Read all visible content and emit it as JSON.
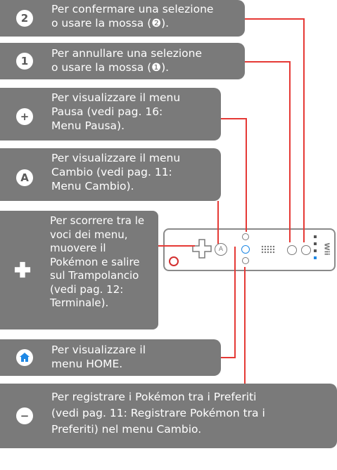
{
  "boxes": [
    {
      "icon": "2",
      "lines": [
        "Per confermare una selezione",
        "o usare la mossa (❷)."
      ]
    },
    {
      "icon": "1",
      "lines": [
        "Per annullare una selezione",
        "o usare la mossa (❶)."
      ]
    },
    {
      "icon": "+",
      "lines": [
        "Per visualizzare il menu",
        "Pausa (vedi pag. 16:",
        "Menu Pausa)."
      ]
    },
    {
      "icon": "A",
      "lines": [
        "Per visualizzare il menu",
        "Cambio (vedi pag. 11:",
        "Menu Cambio)."
      ]
    },
    {
      "icon": "dpad",
      "lines": [
        "Per scorrere tra le",
        "voci dei menu,",
        "muovere il",
        "Pokémon e salire",
        "sul Trampolancio",
        "(vedi pag. 12:",
        "Terminale)."
      ]
    },
    {
      "icon": "home",
      "lines": [
        "Per visualizzare il",
        "menu HOME."
      ]
    },
    {
      "icon": "−",
      "lines": [
        "Per registrare i Pokémon tra i Preferiti",
        "(vedi pag. 11: Registrare Pokémon tra i",
        "Preferiti) nel menu Cambio."
      ]
    }
  ],
  "colors": {
    "box": "#7a7a7a",
    "line": "#e53935"
  },
  "remote_label": "Wii"
}
